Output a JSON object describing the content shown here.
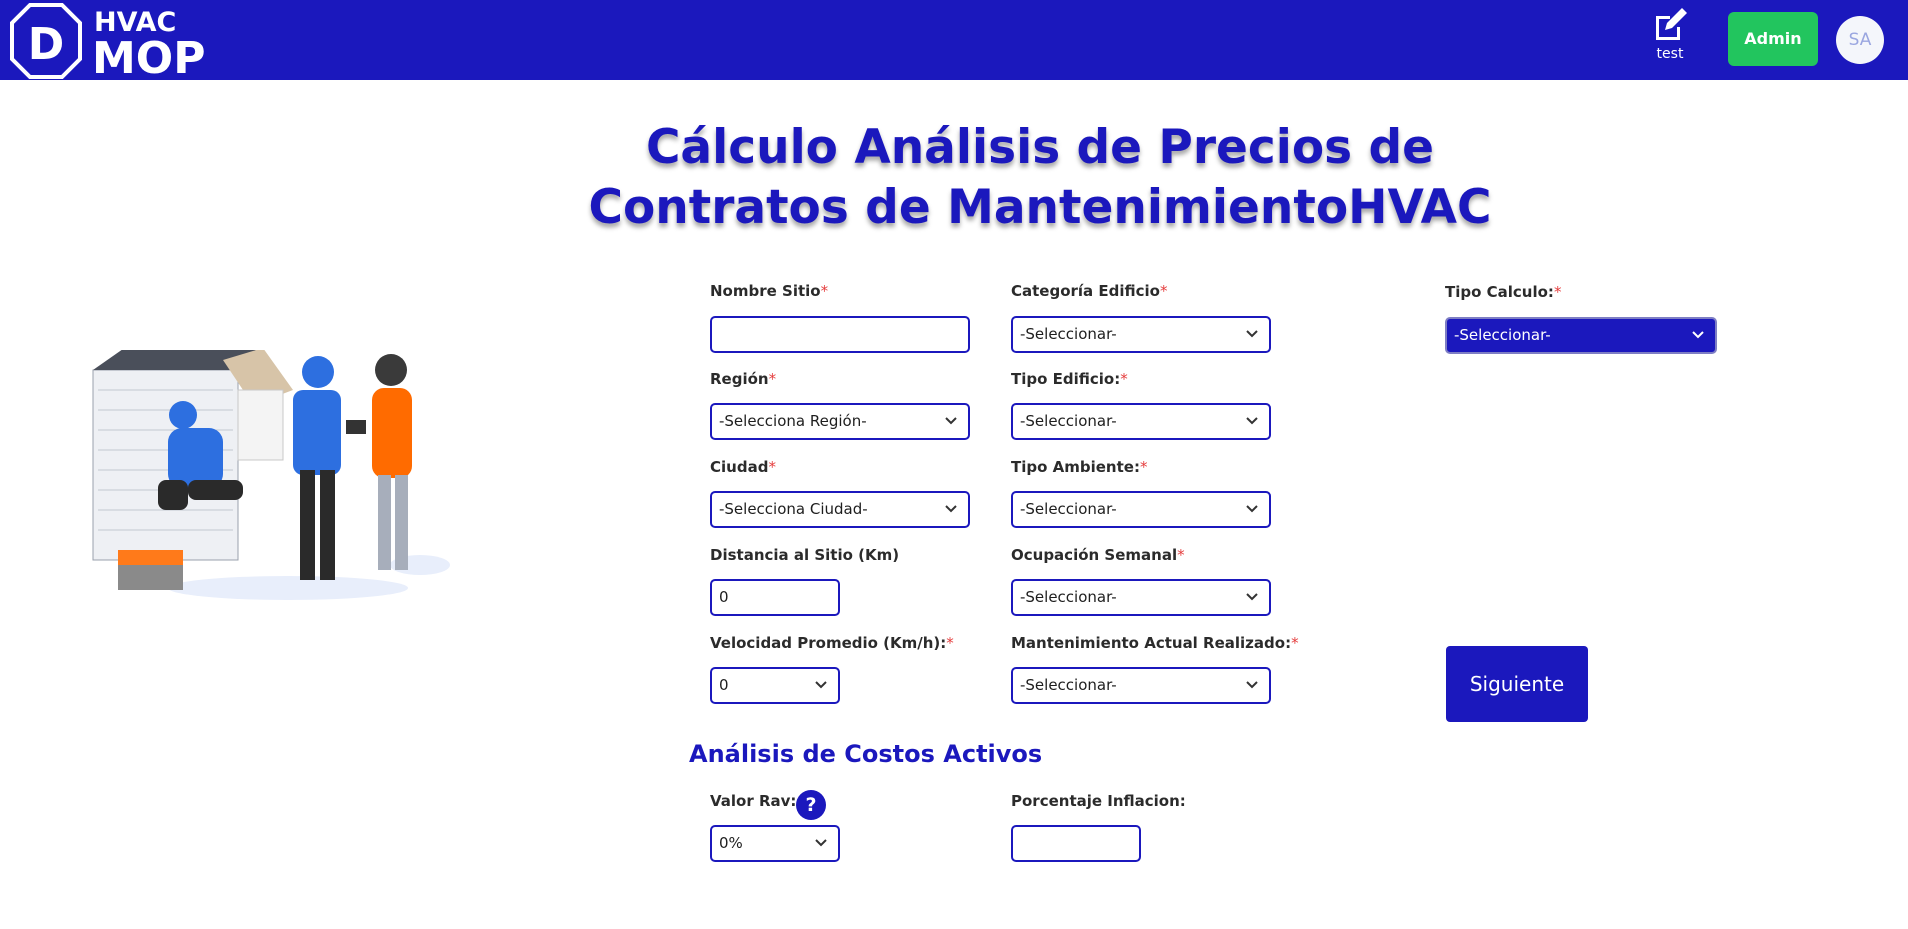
{
  "header": {
    "logo_top": "HVAC",
    "logo_bottom": "MOP",
    "logo_letter": "D",
    "edit_label": "test",
    "admin_label": "Admin",
    "avatar_initials": "SA"
  },
  "title": {
    "line1": "Cálculo Análisis de Precios de",
    "line2": "Contratos de MantenimientoHVAC"
  },
  "form": {
    "nombre_sitio": {
      "label": "Nombre Sitio",
      "value": ""
    },
    "categoria_edificio": {
      "label": "Categoría Edificio",
      "value": "-Seleccionar-"
    },
    "tipo_calculo": {
      "label": "Tipo Calculo:",
      "value": "-Seleccionar-"
    },
    "region": {
      "label": "Región",
      "value": "-Selecciona Región-"
    },
    "tipo_edificio": {
      "label": "Tipo Edificio:",
      "value": "-Seleccionar-"
    },
    "ciudad": {
      "label": "Ciudad",
      "value": "-Selecciona Ciudad-"
    },
    "tipo_ambiente": {
      "label": "Tipo Ambiente:",
      "value": "-Seleccionar-"
    },
    "distancia": {
      "label": "Distancia al Sitio (Km)",
      "value": "0"
    },
    "ocupacion": {
      "label": "Ocupación Semanal",
      "value": "-Seleccionar-"
    },
    "velocidad": {
      "label": "Velocidad Promedio (Km/h):",
      "value": "0"
    },
    "mantenimiento": {
      "label": "Mantenimiento Actual Realizado:",
      "value": "-Seleccionar-"
    },
    "required_mark": "*"
  },
  "next_button": "Siguiente",
  "costos": {
    "section_title": "Análisis de Costos Activos",
    "valor_rav": {
      "label": "Valor Rav:",
      "value": "0%"
    },
    "help_glyph": "?",
    "inflacion": {
      "label": "Porcentaje Inflacion:",
      "value": ""
    }
  },
  "colors": {
    "brand": "#1b18bd",
    "admin": "#22c55e",
    "required": "#e53e3e"
  }
}
